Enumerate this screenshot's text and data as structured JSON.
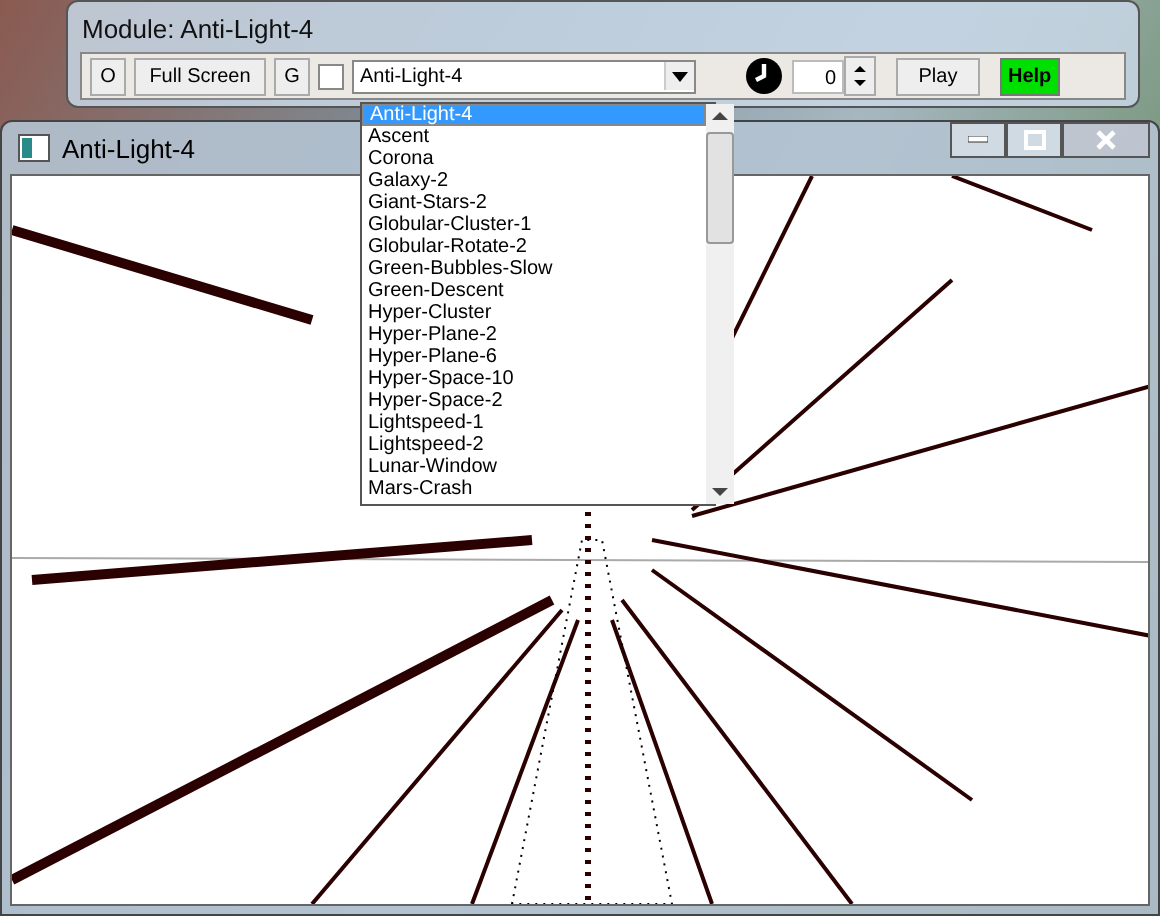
{
  "toolbar_window": {
    "title": "Module: Anti-Light-4"
  },
  "toolbar": {
    "o_button": "O",
    "fullscreen_button": "Full Screen",
    "g_button": "G",
    "checkbox": {
      "checked": false
    },
    "module_select": "Anti-Light-4",
    "spin_value": "0",
    "play_button": "Play",
    "help_button": "Help"
  },
  "dropdown": {
    "items": [
      {
        "label": "Anti-Light-4",
        "selected": true
      },
      {
        "label": "Ascent",
        "selected": false
      },
      {
        "label": "Corona",
        "selected": false
      },
      {
        "label": "Galaxy-2",
        "selected": false
      },
      {
        "label": "Giant-Stars-2",
        "selected": false
      },
      {
        "label": "Globular-Cluster-1",
        "selected": false
      },
      {
        "label": "Globular-Rotate-2",
        "selected": false
      },
      {
        "label": "Green-Bubbles-Slow",
        "selected": false
      },
      {
        "label": "Green-Descent",
        "selected": false
      },
      {
        "label": "Hyper-Cluster",
        "selected": false
      },
      {
        "label": "Hyper-Plane-2",
        "selected": false
      },
      {
        "label": "Hyper-Plane-6",
        "selected": false
      },
      {
        "label": "Hyper-Space-10",
        "selected": false
      },
      {
        "label": "Hyper-Space-2",
        "selected": false
      },
      {
        "label": "Lightspeed-1",
        "selected": false
      },
      {
        "label": "Lightspeed-2",
        "selected": false
      },
      {
        "label": "Lunar-Window",
        "selected": false
      },
      {
        "label": "Mars-Crash",
        "selected": false
      }
    ]
  },
  "main_window": {
    "title": "Anti-Light-4"
  }
}
